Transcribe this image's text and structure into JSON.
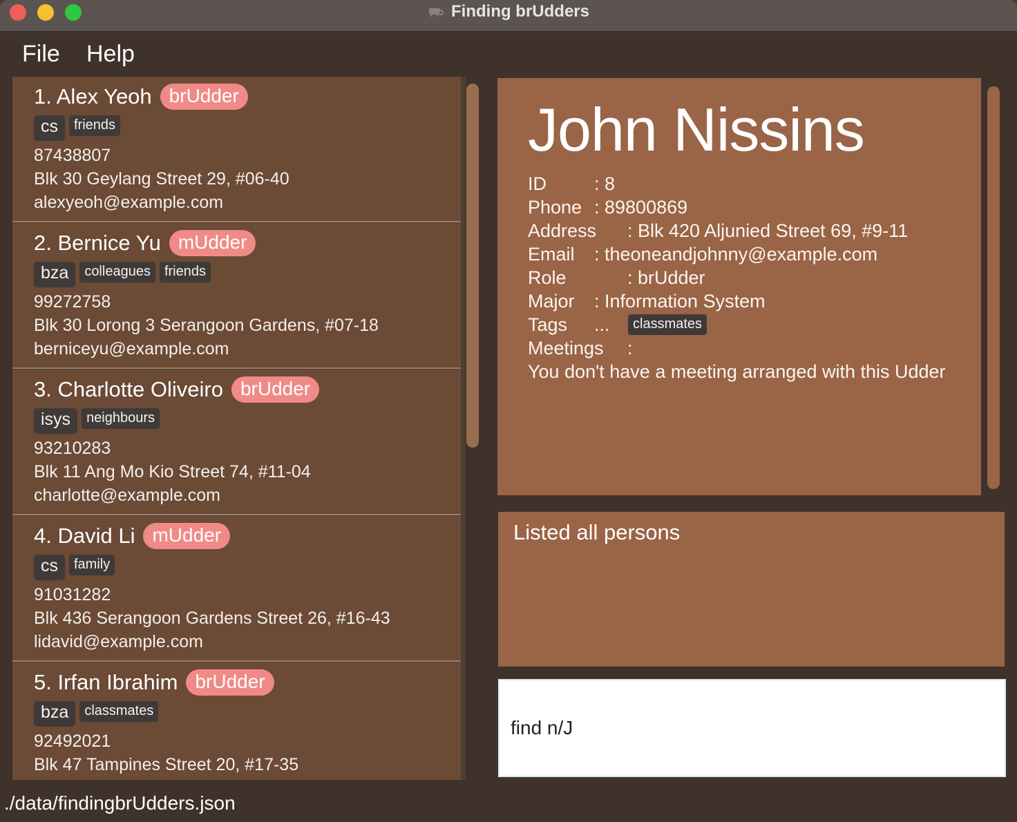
{
  "window": {
    "title": "Finding brUdders"
  },
  "menu": {
    "file": "File",
    "help": "Help"
  },
  "persons": [
    {
      "index_name": "1. Alex Yeoh",
      "role": "brUdder",
      "major": "cs",
      "tags": [
        "friends"
      ],
      "phone": "87438807",
      "address": "Blk 30 Geylang Street 29, #06-40",
      "email": "alexyeoh@example.com"
    },
    {
      "index_name": "2. Bernice Yu",
      "role": "mUdder",
      "major": "bza",
      "tags": [
        "colleagues",
        "friends"
      ],
      "phone": "99272758",
      "address": "Blk 30 Lorong 3 Serangoon Gardens, #07-18",
      "email": "berniceyu@example.com"
    },
    {
      "index_name": "3. Charlotte Oliveiro",
      "role": "brUdder",
      "major": "isys",
      "tags": [
        "neighbours"
      ],
      "phone": "93210283",
      "address": "Blk 11 Ang Mo Kio Street 74, #11-04",
      "email": "charlotte@example.com"
    },
    {
      "index_name": "4. David Li",
      "role": "mUdder",
      "major": "cs",
      "tags": [
        "family"
      ],
      "phone": "91031282",
      "address": "Blk 436 Serangoon Gardens Street 26, #16-43",
      "email": "lidavid@example.com"
    },
    {
      "index_name": "5. Irfan Ibrahim",
      "role": "brUdder",
      "major": "bza",
      "tags": [
        "classmates"
      ],
      "phone": "92492021",
      "address": "Blk 47 Tampines Street 20, #17-35",
      "email": ""
    }
  ],
  "detail": {
    "name": "John Nissins",
    "id_label": "ID",
    "id_value": ": 8",
    "phone_label": "Phone",
    "phone_value": ": 89800869",
    "address_label": "Address",
    "address_value": ": Blk 420 Aljunied Street 69, #9-11",
    "email_label": "Email",
    "email_value": ": theoneandjohnny@example.com",
    "role_label": "Role",
    "role_value": ": brUdder",
    "major_label": "Major",
    "major_value": ": Information System",
    "tags_label": "Tags",
    "tags_value": "...",
    "tag": "classmates",
    "meetings_label": "Meetings",
    "meetings_value": ":",
    "meeting_note": "You don't have a meeting arranged with this Udder"
  },
  "result": {
    "text": "Listed all persons"
  },
  "command": {
    "value": "find n/J"
  },
  "status": {
    "path": "./data/findingbrUdders.json"
  }
}
